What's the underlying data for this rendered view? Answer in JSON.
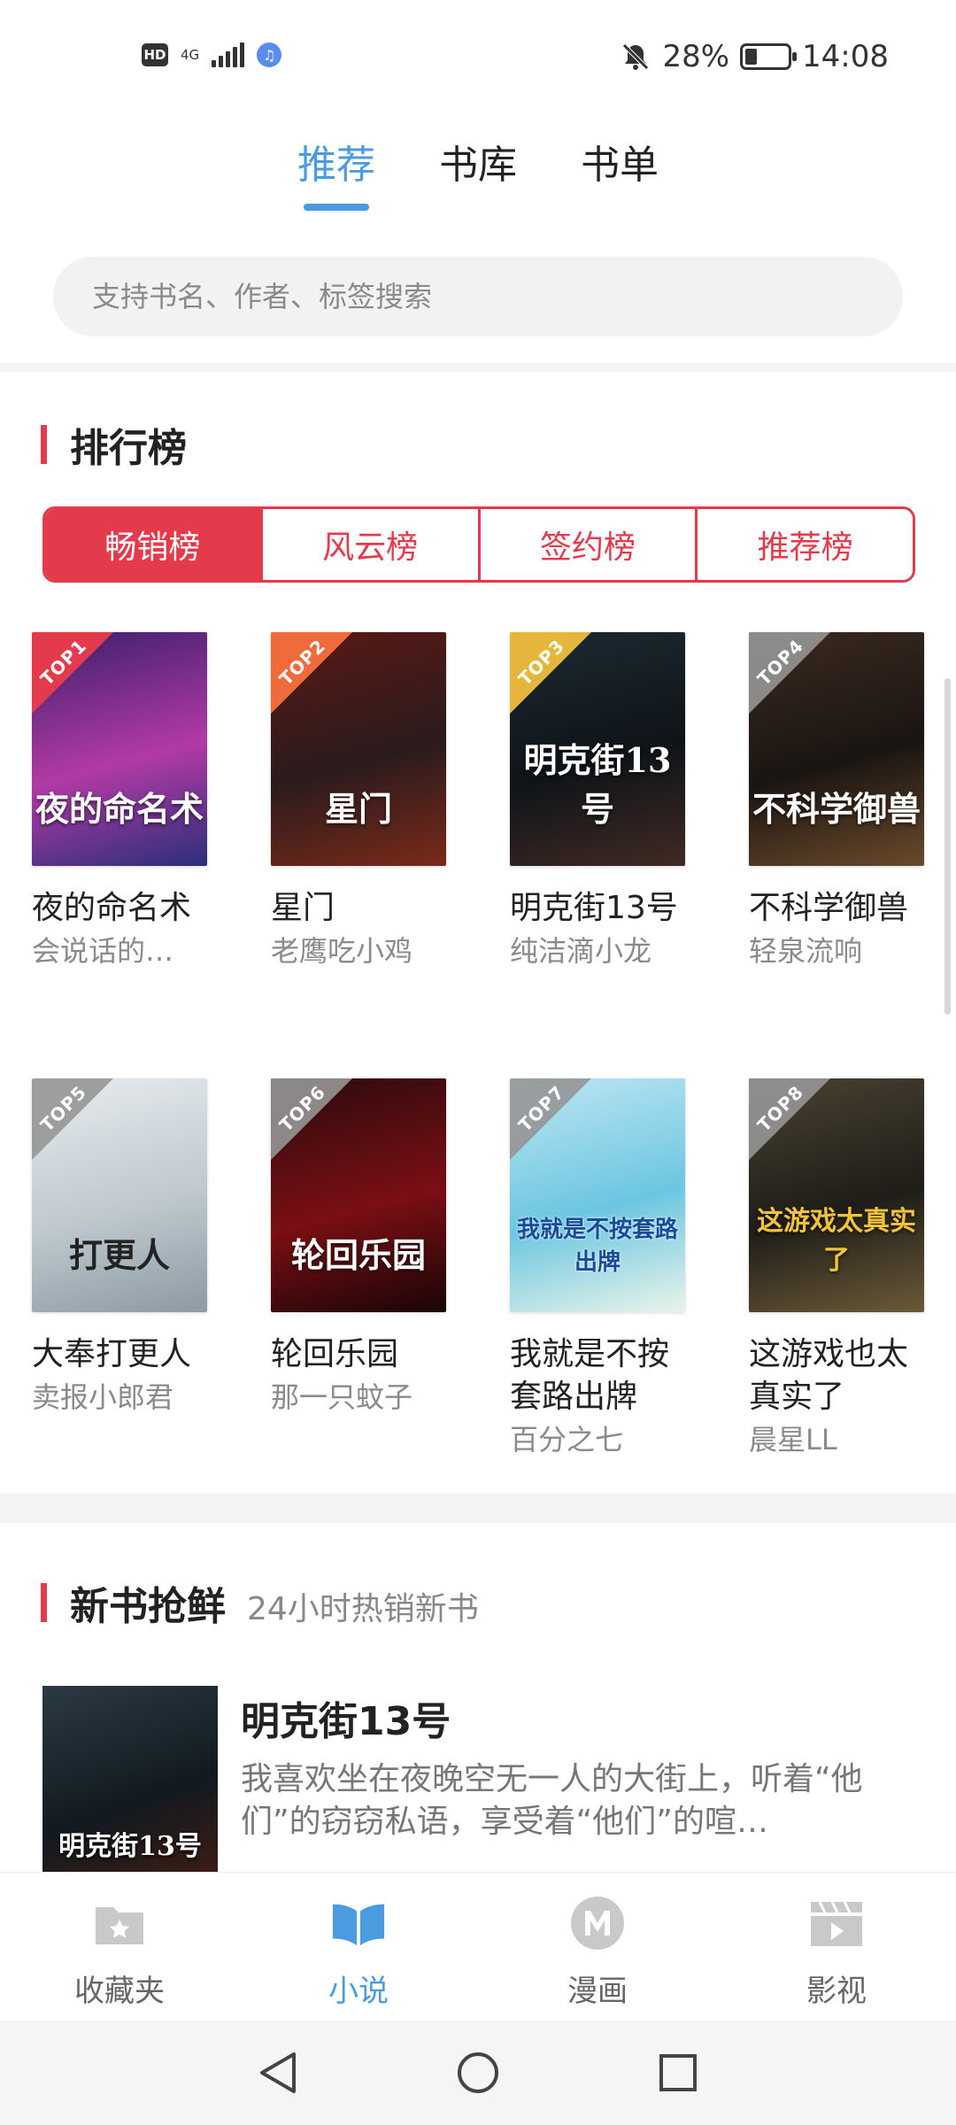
{
  "status_bar": {
    "hd": "HD",
    "network": "4G",
    "battery": "28%",
    "battery_level": 0.28,
    "time": "14:08"
  },
  "top_tabs": [
    {
      "label": "推荐",
      "active": true
    },
    {
      "label": "书库",
      "active": false
    },
    {
      "label": "书单",
      "active": false
    }
  ],
  "search": {
    "placeholder": "支持书名、作者、标签搜索"
  },
  "ranking": {
    "title": "排行榜",
    "tabs": [
      {
        "label": "畅销榜",
        "active": true
      },
      {
        "label": "风云榜",
        "active": false
      },
      {
        "label": "签约榜",
        "active": false
      },
      {
        "label": "推荐榜",
        "active": false
      }
    ],
    "books": [
      {
        "rank": "TOP1",
        "cover_text": "夜的命名术",
        "title": "夜的命名术",
        "author": "会说话的…",
        "colors": [
          "#3a1f6b",
          "#b23aa5",
          "#2b2f7a"
        ]
      },
      {
        "rank": "TOP2",
        "cover_text": "星门",
        "title": "星门",
        "author": "老鹰吃小鸡",
        "colors": [
          "#5a1a14",
          "#2b1b1d",
          "#7a2a18"
        ]
      },
      {
        "rank": "TOP3",
        "cover_text": "明克街13号",
        "title": "明克街13号",
        "author": "纯洁滴小龙",
        "colors": [
          "#1d2a33",
          "#0f1418",
          "#402a24"
        ]
      },
      {
        "rank": "TOP4",
        "cover_text": "不科学御兽",
        "title": "不科学御兽",
        "author": "轻泉流响",
        "colors": [
          "#3b2a20",
          "#1a1512",
          "#6a4a2a"
        ]
      },
      {
        "rank": "TOP5",
        "cover_text": "打更人",
        "title": "大奉打更人",
        "author": "卖报小郎君",
        "colors": [
          "#e8ecef",
          "#bfc9cf",
          "#8c9aa3"
        ]
      },
      {
        "rank": "TOP6",
        "cover_text": "轮回乐园",
        "title": "轮回乐园",
        "author": "那一只蚊子",
        "colors": [
          "#2a0b0d",
          "#7a0f14",
          "#1a0506"
        ]
      },
      {
        "rank": "TOP7",
        "cover_text": "我就是不按套路出牌",
        "title": "我就是不按套路出牌",
        "author": "百分之七",
        "colors": [
          "#bfe6f3",
          "#6cc6e0",
          "#e9f4ea"
        ]
      },
      {
        "rank": "TOP8",
        "cover_text": "这游戏太真实了",
        "title": "这游戏也太真实了",
        "author": "晨星LL",
        "colors": [
          "#4a4232",
          "#1f1d18",
          "#6b5a38"
        ]
      }
    ]
  },
  "new_books": {
    "title": "新书抢鲜",
    "subtitle": "24小时热销新书",
    "featured": {
      "title": "明克街13号",
      "description": "我喜欢坐在夜晚空无一人的大街上，听着“他们”的窃窃私语，享受着“他们”的喧…",
      "cover_text": "明克街13号"
    }
  },
  "bottom_nav": [
    {
      "label": "收藏夹",
      "icon": "favorites-folder-icon",
      "active": false
    },
    {
      "label": "小说",
      "icon": "open-book-icon",
      "active": true
    },
    {
      "label": "漫画",
      "icon": "comic-m-icon",
      "active": false
    },
    {
      "label": "影视",
      "icon": "video-clapper-icon",
      "active": false
    }
  ],
  "system_nav": [
    "back-icon",
    "home-icon",
    "recents-icon"
  ],
  "colors": {
    "accent_blue": "#4a9bdf",
    "accent_red": "#e33b4b"
  }
}
